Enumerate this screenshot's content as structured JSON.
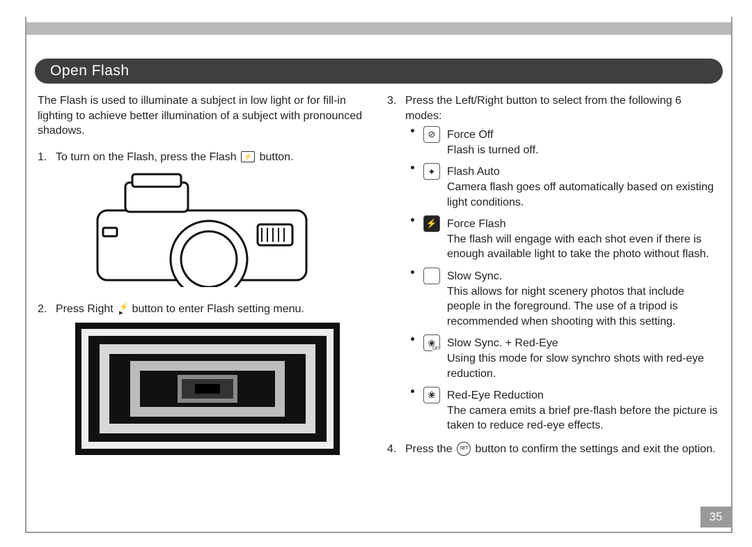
{
  "page_number": "35",
  "section_title": "Open Flash",
  "intro": "The Flash is used to illuminate a subject in low light or for fill-in lighting to achieve better illumination of a subject with pronounced shadows.",
  "steps": {
    "s1_num": "1.",
    "s1_a": "To turn on the Flash, press the Flash",
    "s1_b": "button.",
    "s2_num": "2.",
    "s2_a": "Press Right",
    "s2_b": "button to enter Flash setting menu.",
    "s3_num": "3.",
    "s3": "Press the Left/Right button to select from the following 6 modes:",
    "s4_num": "4.",
    "s4_a": "Press the",
    "s4_b": "button to confirm the settings and exit the option."
  },
  "modes": [
    {
      "name": "Force Off",
      "desc": "Flash is turned off."
    },
    {
      "name": "Flash Auto",
      "desc": "Camera flash goes off automatically based on existing light conditions."
    },
    {
      "name": "Force Flash",
      "desc": "The flash will engage with each shot even if there is enough available light to take the photo without flash."
    },
    {
      "name": "Slow Sync.",
      "desc": "This allows for night scenery photos that include people in the foreground. The use of a tripod is recommended when shooting with this setting."
    },
    {
      "name": "Slow Sync. + Red-Eye",
      "desc": "Using this mode for slow synchro shots with red-eye reduction."
    },
    {
      "name": "Red-Eye Reduction",
      "desc": "The camera emits a brief pre-flash before the picture is taken to reduce red-eye effects."
    }
  ]
}
